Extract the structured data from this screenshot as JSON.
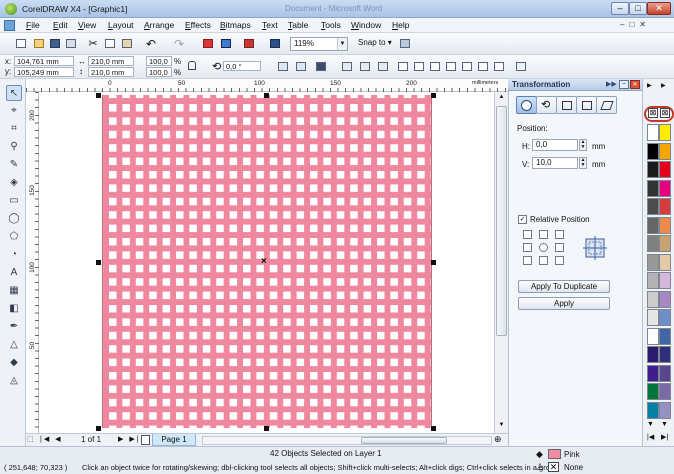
{
  "window": {
    "title": "CorelDRAW X4 - [Graphic1]",
    "ghost_title": "Document - Microsoft Word",
    "min": "–",
    "max": "□",
    "close": "✕"
  },
  "menu": [
    {
      "label": "File",
      "u": "F",
      "rest": "ile"
    },
    {
      "label": "Edit",
      "u": "E",
      "rest": "dit"
    },
    {
      "label": "View",
      "u": "V",
      "rest": "iew"
    },
    {
      "label": "Layout",
      "u": "L",
      "rest": "ayout"
    },
    {
      "label": "Arrange",
      "u": "A",
      "rest": "rrange"
    },
    {
      "label": "Effects",
      "u": "E",
      "rest": "ffects"
    },
    {
      "label": "Bitmaps",
      "u": "B",
      "rest": "itmaps"
    },
    {
      "label": "Text",
      "u": "T",
      "rest": "ext"
    },
    {
      "label": "Table",
      "u": "T",
      "rest": "able"
    },
    {
      "label": "Tools",
      "u": "T",
      "rest": "ools"
    },
    {
      "label": "Window",
      "u": "W",
      "rest": "indow"
    },
    {
      "label": "Help",
      "u": "H",
      "rest": "elp"
    }
  ],
  "standard_toolbar": {
    "zoom": "119%",
    "snap_to": "Snap to"
  },
  "property_bar": {
    "x_label": "x:",
    "x": "104,761 mm",
    "y_label": "y:",
    "y": "105,249 mm",
    "w": "210,0 mm",
    "h": "210,0 mm",
    "scale_w": "100,0",
    "scale_h": "100,0",
    "pct": "%",
    "angle": "0,0",
    "angle_unit": "°"
  },
  "ruler": {
    "units": "millimeters",
    "h_ticks": [
      "0",
      "50",
      "100",
      "150",
      "200"
    ],
    "v_ticks": [
      "200",
      "150",
      "100",
      "50"
    ]
  },
  "docker": {
    "title": "Transformation",
    "position_label": "Position:",
    "h_label": "H:",
    "h_value": "0,0",
    "h_unit": "mm",
    "v_label": "V:",
    "v_value": "10,0",
    "v_unit": "mm",
    "relative_label": "Relative Position",
    "apply_duplicate": "Apply To Duplicate",
    "apply": "Apply"
  },
  "page_nav": {
    "counter": "1 of 1",
    "page_tab": "Page 1"
  },
  "status": {
    "selection": "42 Objects Selected on Layer 1",
    "coords": "( 251,648; 70,323 )",
    "hint": "Click an object twice for rotating/skewing; dbl-clicking tool selects all objects; Shift+click multi-selects; Alt+click digs; Ctrl+click selects in a group",
    "fill_name": "Pink",
    "outline_name": "None"
  },
  "colors": {
    "pattern_fill": "#ef879f",
    "pattern_square": "#ffffff",
    "pink": "#f28ca4",
    "highlight_circle": "#c0392b"
  },
  "palette": [
    "#ffffff",
    "#000000",
    "#1a1a1a",
    "#333333",
    "#4d4d4d",
    "#666666",
    "#808080",
    "#999999",
    "#b3b3b3",
    "#cccccc",
    "#e6e6e6",
    "#ffffff",
    "#2b1b6e",
    "#3d1e8c",
    "#00753a",
    "#0082a6",
    "#ffec00",
    "#f7a600",
    "#e2001a",
    "#e6007e",
    "#d63c3c",
    "#f08a4b",
    "#c8a26f",
    "#e3c9a6",
    "#d6b8de",
    "#a987c4",
    "#6d8ec9",
    "#4265a8",
    "#2e2e7a",
    "#59458c",
    "#7c6aa8",
    "#9591c6"
  ],
  "icons": {
    "new": "new-document-icon",
    "open": "open-icon",
    "save": "save-icon",
    "print": "print-icon",
    "cut": "cut-icon",
    "copy": "copy-icon",
    "paste": "paste-icon",
    "undo": "undo-icon",
    "redo": "redo-icon",
    "import": "import-icon",
    "export": "export-icon",
    "app_launcher": "app-launcher-icon",
    "welcome": "welcome-screen-icon",
    "options": "options-icon"
  }
}
